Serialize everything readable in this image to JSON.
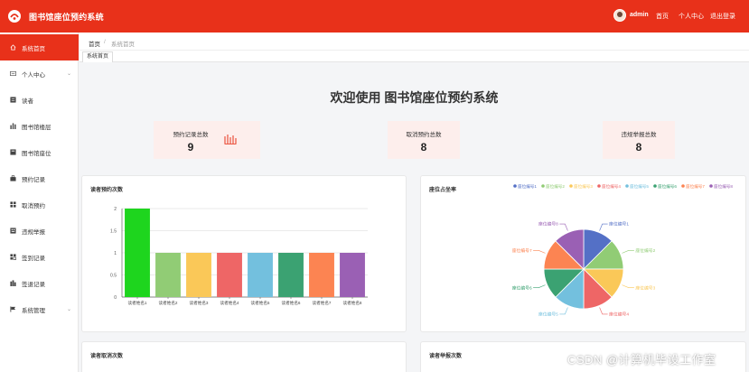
{
  "header": {
    "app_title": "图书馆座位预约系统",
    "username": "admin",
    "links": [
      "首页",
      "个人中心",
      "退出登录"
    ]
  },
  "sidebar": {
    "items": [
      {
        "label": "系统首页",
        "icon": "home-icon",
        "active": true,
        "caret": false
      },
      {
        "label": "个人中心",
        "icon": "user-icon",
        "active": false,
        "caret": true
      },
      {
        "label": "读者",
        "icon": "reader-icon",
        "active": false,
        "caret": false
      },
      {
        "label": "图书馆楼层",
        "icon": "bar-chart-icon",
        "active": false,
        "caret": false
      },
      {
        "label": "图书馆座位",
        "icon": "seat-icon",
        "active": false,
        "caret": false
      },
      {
        "label": "预约记录",
        "icon": "briefcase-icon",
        "active": false,
        "caret": false
      },
      {
        "label": "取消预约",
        "icon": "grid-icon",
        "active": false,
        "caret": false
      },
      {
        "label": "违规举报",
        "icon": "report-icon",
        "active": false,
        "caret": false
      },
      {
        "label": "签到记录",
        "icon": "checkin-icon",
        "active": false,
        "caret": false
      },
      {
        "label": "签退记录",
        "icon": "checkout-icon",
        "active": false,
        "caret": false
      },
      {
        "label": "系统管理",
        "icon": "flag-icon",
        "active": false,
        "caret": true
      }
    ]
  },
  "breadcrumb": {
    "home": "首页",
    "separator": "/",
    "current": "系统首页"
  },
  "tabs": [
    {
      "label": "系统首页"
    }
  ],
  "welcome": "欢迎使用 图书馆座位预约系统",
  "stats": [
    {
      "label": "预约记录总数",
      "value": "9"
    },
    {
      "label": "取消预约总数",
      "value": "8"
    },
    {
      "label": "违规举报总数",
      "value": "8"
    }
  ],
  "panels": {
    "bar_title": "读者预约次数",
    "pie_title": "座位占坐率",
    "cancel_title": "读者取消次数",
    "report_title": "读者举报次数"
  },
  "colors": {
    "accent": "#e8311a",
    "stat_bg": "#fdeeec"
  },
  "chart_data": [
    {
      "type": "bar",
      "title": "读者预约次数",
      "categories": [
        "读者姓名1",
        "读者姓名2",
        "读者姓名3",
        "读者姓名4",
        "读者姓名5",
        "读者姓名6",
        "读者姓名7",
        "读者姓名8"
      ],
      "values": [
        2,
        1,
        1,
        1,
        1,
        1,
        1,
        1
      ],
      "ylim": [
        0,
        2
      ],
      "yticks": [
        "0",
        "0.5",
        "1",
        "1.5",
        "2"
      ],
      "colors": [
        "#1ed51e",
        "#91cc75",
        "#fac858",
        "#ee6666",
        "#73c0de",
        "#3ba272",
        "#fc8452",
        "#9a60b4"
      ],
      "grid": true
    },
    {
      "type": "pie",
      "title": "座位占坐率",
      "labels": [
        "座位编号1",
        "座位编号2",
        "座位编号3",
        "座位编号4",
        "座位编号5",
        "座位编号6",
        "座位编号7",
        "座位编号8"
      ],
      "values": [
        1,
        1,
        1,
        1,
        1,
        1,
        1,
        1
      ],
      "colors": [
        "#5470c6",
        "#91cc75",
        "#fac858",
        "#ee6666",
        "#73c0de",
        "#3ba272",
        "#fc8452",
        "#9a60b4"
      ],
      "legend": "top"
    }
  ],
  "watermark": "CSDN @计算机毕设工作室"
}
